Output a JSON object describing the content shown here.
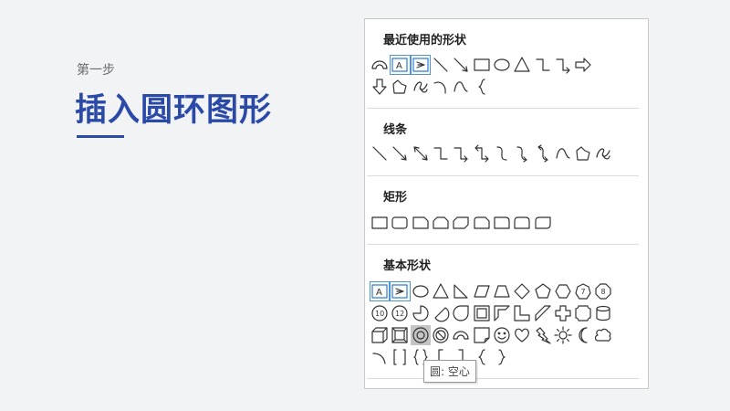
{
  "slide": {
    "step_label": "第一步",
    "title": "插入圆环图形",
    "accent_color": "#2b4aa8"
  },
  "shape_gallery": {
    "sections": [
      {
        "header": "最近使用的形状",
        "rows": [
          [
            "arc-icon",
            "text-box-icon",
            "vertical-text-box-icon",
            "line-icon",
            "arrow-line-icon",
            "rectangle-icon",
            "oval-icon",
            "triangle-icon",
            "elbow-connector-icon",
            "elbow-arrow-connector-icon",
            "right-arrow-icon"
          ],
          [
            "down-arrow-icon",
            "freeform-icon",
            "scribble-icon",
            "arc-curve-icon",
            "curve-icon",
            "left-brace-icon"
          ]
        ]
      },
      {
        "header": "线条",
        "rows": [
          [
            "line-icon",
            "arrow-line-icon",
            "double-arrow-line-icon",
            "elbow-connector-icon",
            "elbow-arrow-connector-icon",
            "elbow-double-arrow-connector-icon",
            "curved-connector-icon",
            "curved-arrow-connector-icon",
            "curved-double-arrow-connector-icon",
            "curve-icon",
            "freeform-icon",
            "scribble-icon"
          ]
        ]
      },
      {
        "header": "矩形",
        "rows": [
          [
            "rectangle-icon",
            "rounded-rectangle-icon",
            "snip-single-corner-rectangle-icon",
            "snip-same-side-rectangle-icon",
            "snip-diagonal-rectangle-icon",
            "snip-round-rectangle-icon",
            "round-single-corner-rectangle-icon",
            "round-same-side-rectangle-icon",
            "round-diagonal-rectangle-icon"
          ]
        ]
      },
      {
        "header": "基本形状",
        "rows": [
          [
            "text-box-icon",
            "vertical-text-box-icon",
            "oval-icon",
            "triangle-icon",
            "right-triangle-icon",
            "parallelogram-icon",
            "trapezoid-icon",
            "diamond-icon",
            "pentagon-icon",
            "hexagon-icon",
            "heptagon-icon",
            "octagon-icon"
          ],
          [
            "decagon-icon",
            "dodecagon-icon",
            "pie-icon",
            "chord-icon",
            "teardrop-icon",
            "frame-icon",
            "half-frame-icon",
            "l-shape-icon",
            "diagonal-stripe-icon",
            "cross-icon",
            "plaque-icon",
            "can-icon"
          ],
          [
            "cube-icon",
            "bevel-icon",
            "donut-icon",
            "no-symbol-icon",
            "block-arc-icon",
            "folded-corner-icon",
            "smiley-face-icon",
            "heart-icon",
            "lightning-bolt-icon",
            "sun-icon",
            "moon-icon",
            "cloud-icon"
          ],
          [
            "arc-bracket-icon",
            "double-bracket-icon",
            "double-brace-icon",
            "left-bracket-icon",
            "right-bracket-icon",
            "left-brace-icon",
            "right-brace-icon"
          ]
        ]
      }
    ],
    "tooltip": "圆: 空心",
    "hovered_icon": "donut-icon",
    "hover_color": "#c4c4c4",
    "highlight_color": "#4e94d6"
  }
}
